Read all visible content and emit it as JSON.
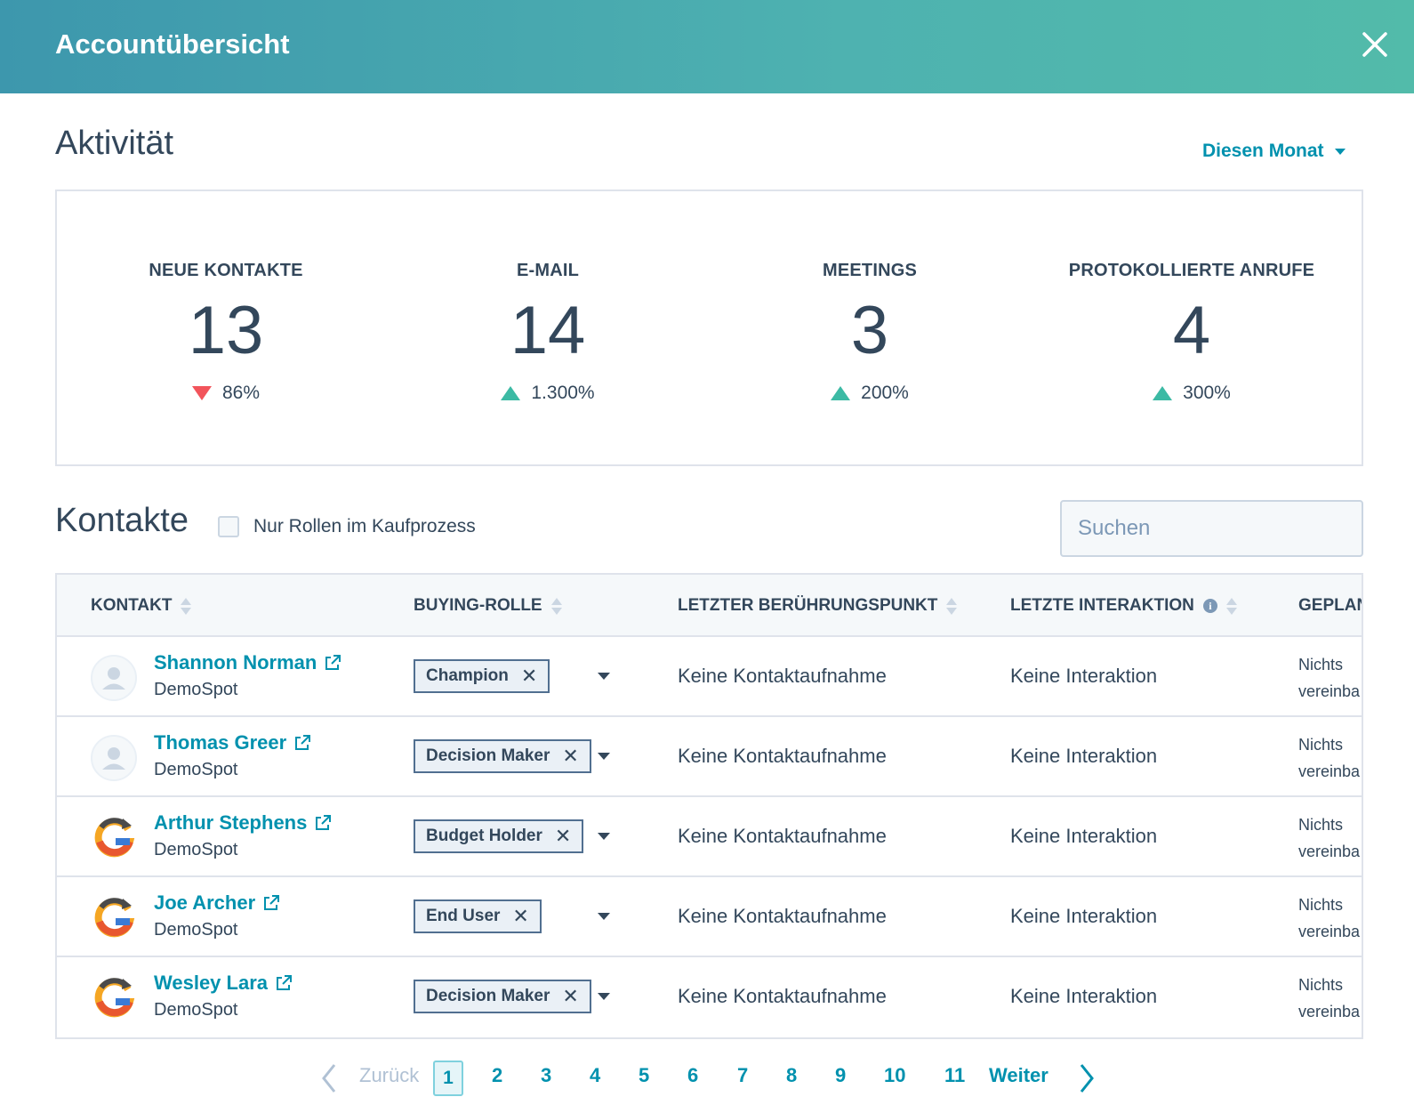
{
  "header": {
    "title": "Accountübersicht"
  },
  "activity": {
    "title": "Aktivität",
    "period": "Diesen Monat",
    "stats": [
      {
        "label": "NEUE KONTAKTE",
        "value": "13",
        "change": "86%",
        "direction": "down"
      },
      {
        "label": "E-MAIL",
        "value": "14",
        "change": "1.300%",
        "direction": "up"
      },
      {
        "label": "MEETINGS",
        "value": "3",
        "change": "200%",
        "direction": "up"
      },
      {
        "label": "PROTOKOLLIERTE ANRUFE",
        "value": "4",
        "change": "300%",
        "direction": "up"
      }
    ]
  },
  "contacts": {
    "title": "Kontakte",
    "filter_label": "Nur Rollen im Kaufprozess",
    "search_placeholder": "Suchen",
    "columns": [
      "KONTAKT",
      "BUYING-ROLLE",
      "LETZTER BERÜHRUNGSPUNKT",
      "LETZTE INTERAKTION",
      "GEPLAN"
    ],
    "rows": [
      {
        "name": "Shannon Norman",
        "company": "DemoSpot",
        "role": "Champion",
        "last_touch": "Keine Kontaktaufnahme",
        "last_interaction": "Keine Interaktion",
        "planned_1": "Nichts",
        "planned_2": "vereinba",
        "avatar": "person-avatar"
      },
      {
        "name": "Thomas Greer",
        "company": "DemoSpot",
        "role": "Decision Maker",
        "last_touch": "Keine Kontaktaufnahme",
        "last_interaction": "Keine Interaktion",
        "planned_1": "Nichts",
        "planned_2": "vereinba",
        "avatar": "person-avatar"
      },
      {
        "name": "Arthur Stephens",
        "company": "DemoSpot",
        "role": "Budget Holder",
        "last_touch": "Keine Kontaktaufnahme",
        "last_interaction": "Keine Interaktion",
        "planned_1": "Nichts",
        "planned_2": "vereinba",
        "avatar": "company-logo"
      },
      {
        "name": "Joe Archer",
        "company": "DemoSpot",
        "role": "End User",
        "last_touch": "Keine Kontaktaufnahme",
        "last_interaction": "Keine Interaktion",
        "planned_1": "Nichts",
        "planned_2": "vereinba",
        "avatar": "company-logo"
      },
      {
        "name": "Wesley Lara",
        "company": "DemoSpot",
        "role": "Decision Maker",
        "last_touch": "Keine Kontaktaufnahme",
        "last_interaction": "Keine Interaktion",
        "planned_1": "Nichts",
        "planned_2": "vereinba",
        "avatar": "company-logo"
      }
    ]
  },
  "pagination": {
    "prev": "Zurück",
    "next": "Weiter",
    "current": "1",
    "pages": [
      "2",
      "3",
      "4",
      "5",
      "6",
      "7",
      "8",
      "9",
      "10",
      "11"
    ]
  },
  "colors": {
    "accent": "#0091ae",
    "header_start": "#3d97ad",
    "header_end": "#52bbaa",
    "down": "#f2545b",
    "up": "#3cbaa4"
  }
}
